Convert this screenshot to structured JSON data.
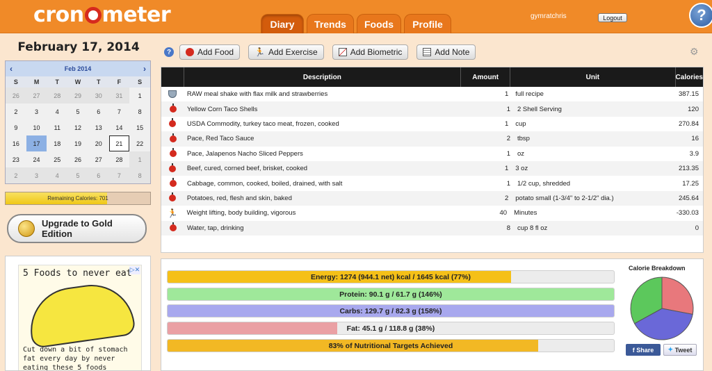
{
  "header": {
    "logo_left": "cron",
    "logo_right": "meter",
    "tabs": [
      "Diary",
      "Trends",
      "Foods",
      "Profile"
    ],
    "active_tab": "Diary",
    "username": "gymratchris",
    "logout_label": "Logout",
    "help_label": "?"
  },
  "sidebar": {
    "date_title": "February 17, 2014",
    "calendar": {
      "month_label": "Feb 2014",
      "prev": "‹",
      "next": "›",
      "weekdays": [
        "S",
        "M",
        "T",
        "W",
        "T",
        "F",
        "S"
      ],
      "selected_day": "17",
      "today_day": "21",
      "weeks": [
        [
          [
            "26",
            1
          ],
          [
            "27",
            1
          ],
          [
            "28",
            1
          ],
          [
            "29",
            1
          ],
          [
            "30",
            1
          ],
          [
            "31",
            1
          ],
          [
            "1",
            0
          ]
        ],
        [
          [
            "2",
            0
          ],
          [
            "3",
            0
          ],
          [
            "4",
            0
          ],
          [
            "5",
            0
          ],
          [
            "6",
            0
          ],
          [
            "7",
            0
          ],
          [
            "8",
            0
          ]
        ],
        [
          [
            "9",
            0
          ],
          [
            "10",
            0
          ],
          [
            "11",
            0
          ],
          [
            "12",
            0
          ],
          [
            "13",
            0
          ],
          [
            "14",
            0
          ],
          [
            "15",
            0
          ]
        ],
        [
          [
            "16",
            0
          ],
          [
            "17",
            0
          ],
          [
            "18",
            0
          ],
          [
            "19",
            0
          ],
          [
            "20",
            0
          ],
          [
            "21",
            0
          ],
          [
            "22",
            0
          ]
        ],
        [
          [
            "23",
            0
          ],
          [
            "24",
            0
          ],
          [
            "25",
            0
          ],
          [
            "26",
            0
          ],
          [
            "27",
            0
          ],
          [
            "28",
            0
          ],
          [
            "1",
            1
          ]
        ],
        [
          [
            "2",
            1
          ],
          [
            "3",
            1
          ],
          [
            "4",
            1
          ],
          [
            "5",
            1
          ],
          [
            "6",
            1
          ],
          [
            "7",
            1
          ],
          [
            "8",
            1
          ]
        ]
      ]
    },
    "remaining_calories": "Remaining Calories: 701",
    "remaining_fraction": 0.7,
    "upgrade_label": "Upgrade to Gold Edition",
    "ad": {
      "title": "5 Foods to never eat",
      "text": "Cut down a bit of stomach fat every day by never eating these 5 foods"
    }
  },
  "toolbar": {
    "add_food": "Add Food",
    "add_exercise": "Add Exercise",
    "add_biometric": "Add Biometric",
    "add_note": "Add Note"
  },
  "table": {
    "headers": {
      "description": "Description",
      "amount": "Amount",
      "unit": "Unit",
      "calories": "Calories"
    },
    "rows": [
      {
        "icon": "mix",
        "description": "RAW meal shake with flax milk and strawberries",
        "amount": "1",
        "unit": "full recipe",
        "calories": "387.15"
      },
      {
        "icon": "food",
        "description": "Yellow Corn Taco Shells",
        "amount": "1",
        "unit": "2 Shell Serving",
        "calories": "120"
      },
      {
        "icon": "food",
        "description": "USDA Commodity, turkey taco meat, frozen, cooked",
        "amount": "1",
        "unit": "cup",
        "calories": "270.84"
      },
      {
        "icon": "food",
        "description": "Pace, Red Taco Sauce",
        "amount": "2",
        "unit": "tbsp",
        "calories": "16"
      },
      {
        "icon": "food",
        "description": "Pace, Jalapenos Nacho Sliced Peppers",
        "amount": "1",
        "unit": "oz",
        "calories": "3.9"
      },
      {
        "icon": "food",
        "description": "Beef, cured, corned beef, brisket, cooked",
        "amount": "1",
        "unit": "3 oz",
        "calories": "213.35"
      },
      {
        "icon": "food",
        "description": "Cabbage, common, cooked, boiled, drained, with salt",
        "amount": "1",
        "unit": "1/2 cup, shredded",
        "calories": "17.25"
      },
      {
        "icon": "food",
        "description": "Potatoes, red, flesh and skin, baked",
        "amount": "2",
        "unit": "potato small (1-3/4\" to 2-1/2\" dia.)",
        "calories": "245.64"
      },
      {
        "icon": "exercise",
        "description": "Weight lifting, body building, vigorous",
        "amount": "40",
        "unit": "Minutes",
        "calories": "-330.03"
      },
      {
        "icon": "food",
        "description": "Water, tap, drinking",
        "amount": "8",
        "unit": "cup 8 fl oz",
        "calories": "0"
      }
    ]
  },
  "nutrition": {
    "bars": [
      {
        "name": "energy",
        "label": "Energy: 1274 (944.1 net) kcal / 1645 kcal (77%)",
        "fraction": 0.77,
        "color": "#f5c018"
      },
      {
        "name": "protein",
        "label": "Protein: 90.1 g / 61.7 g (146%)",
        "fraction": 1.0,
        "color": "#9fe89a"
      },
      {
        "name": "carbs",
        "label": "Carbs: 129.7 g / 82.3 g (158%)",
        "fraction": 1.0,
        "color": "#a8a8ee"
      },
      {
        "name": "fat",
        "label": "Fat: 45.1 g / 118.8 g (38%)",
        "fraction": 0.38,
        "color": "#eaa0a4"
      },
      {
        "name": "targets",
        "label": "83% of Nutritional Targets Achieved",
        "fraction": 0.83,
        "color": "#f2b824"
      }
    ],
    "breakdown_title": "Calorie Breakdown",
    "breakdown": [
      {
        "name": "fat",
        "value": 0.28,
        "color": "#e8787c"
      },
      {
        "name": "carbs",
        "value": 0.39,
        "color": "#6a68d8"
      },
      {
        "name": "protein",
        "value": 0.33,
        "color": "#5cc85c"
      }
    ],
    "share_label": "Share",
    "tweet_label": "Tweet"
  }
}
